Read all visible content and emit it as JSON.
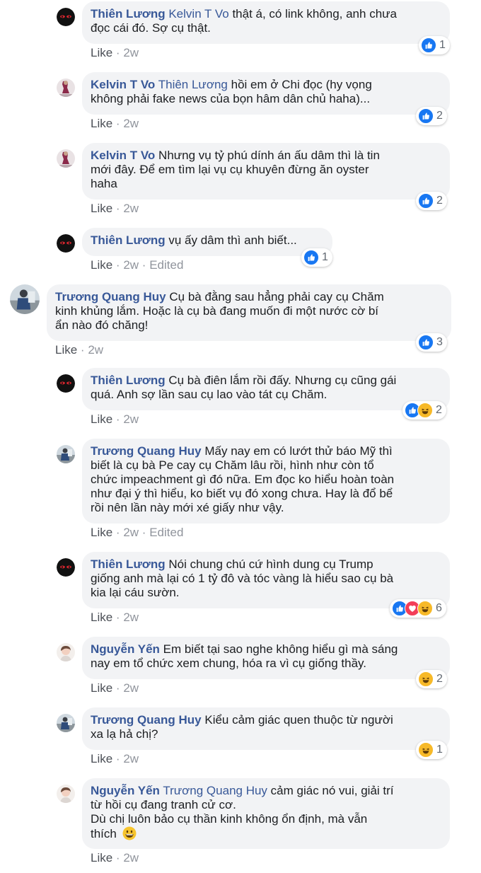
{
  "comments": [
    {
      "author": "Thiên Lương",
      "mention": "Kelvin T Vo",
      "line1": "thật á, có link không, anh chưa",
      "line2": "đọc cái đó. Sợ cụ thật.",
      "like": "Like",
      "time": "2w",
      "reacts": "1"
    },
    {
      "author": "Kelvin T Vo",
      "mention": "Thiên Lương",
      "line1": "hồi em ở Chi đọc (hy vọng",
      "line2": "không phải fake news của bọn hâm dân chủ haha)...",
      "like": "Like",
      "time": "2w",
      "reacts": "2"
    },
    {
      "author": "Kelvin T Vo",
      "line1": "Nhưng vụ tỷ phú dính án ấu dâm thì là tin",
      "line2": "mới đây. Để em tìm lại vụ cụ khuyên đừng ăn oyster",
      "line3": "haha",
      "like": "Like",
      "time": "2w",
      "reacts": "2"
    },
    {
      "author": "Thiên Lương",
      "line1": "vụ ấy dâm thì anh biết...",
      "like": "Like",
      "time": "2w",
      "edited": "Edited",
      "reacts": "1"
    },
    {
      "author": "Trương Quang Huy",
      "line1": "Cụ bà đằng sau hẳng phải cay cụ Chăm",
      "line2": "kinh khủng lắm. Hoặc là cụ bà đang muốn đi một nước cờ bí",
      "line3": "ẩn nào đó chăng!",
      "like": "Like",
      "time": "2w",
      "reacts": "3"
    },
    {
      "author": "Thiên Lương",
      "line1": "Cụ bà điên lắm rồi đấy. Nhưng cụ cũng gái",
      "line2": "quá. Anh sợ lần sau cụ lao vào tát cụ Chăm.",
      "like": "Like",
      "time": "2w",
      "reacts": "2"
    },
    {
      "author": "Trương Quang Huy",
      "line1": "Mấy nay em có lướt thử báo Mỹ thì",
      "line2": "biết là cụ bà Pe cay cụ Chăm lâu rồi, hình như còn tổ",
      "line3": "chức impeachment gì đó nữa. Em đọc ko hiểu hoàn toàn",
      "line4": "như đại ý thì hiểu, ko biết vụ đó xong chưa. Hay là đổ bể",
      "line5": "rồi nên lần này mới xé giấy như vậy.",
      "like": "Like",
      "time": "2w",
      "edited": "Edited"
    },
    {
      "author": "Thiên Lương",
      "line1": "Nói chung chú cứ hình dung cụ Trump",
      "line2": "giống anh mà lại có 1 tỷ đô và tóc vàng là hiểu sao cụ bà",
      "line3": "kia lại cáu sườn.",
      "like": "Like",
      "time": "2w",
      "reacts": "6"
    },
    {
      "author": "Nguyễn Yến",
      "line1": "Em biết tại sao nghe không hiểu gì mà sáng",
      "line2": "nay em tổ chức xem chung, hóa ra vì cụ giống thầy.",
      "like": "Like",
      "time": "2w",
      "reacts": "2"
    },
    {
      "author": "Trương Quang Huy",
      "line1": "Kiểu cảm giác quen thuộc từ người",
      "line2": "xa lạ hả chị?",
      "like": "Like",
      "time": "2w",
      "reacts": "1"
    },
    {
      "author": "Nguyễn Yến",
      "mention": "Trương Quang Huy",
      "line1": "cảm giác nó vui, giải trí",
      "line2": "từ hồi cụ đang tranh cử cơ.",
      "line3": "Dù chị luôn bảo cụ thần kinh không ổn định, mà vẫn",
      "line4": "thích",
      "like": "Like",
      "time": "2w"
    }
  ],
  "sep": "·",
  "icons": {
    "like": "like-reaction-icon",
    "love": "love-reaction-icon",
    "haha": "haha-reaction-icon",
    "smile_emoji": "grinning-face-emoji"
  },
  "colors": {
    "name": "#385898",
    "bubble": "#f2f3f5",
    "like": "#1877f2",
    "love": "#f33e58",
    "haha": "#f7b928",
    "meta": "#90949c"
  }
}
